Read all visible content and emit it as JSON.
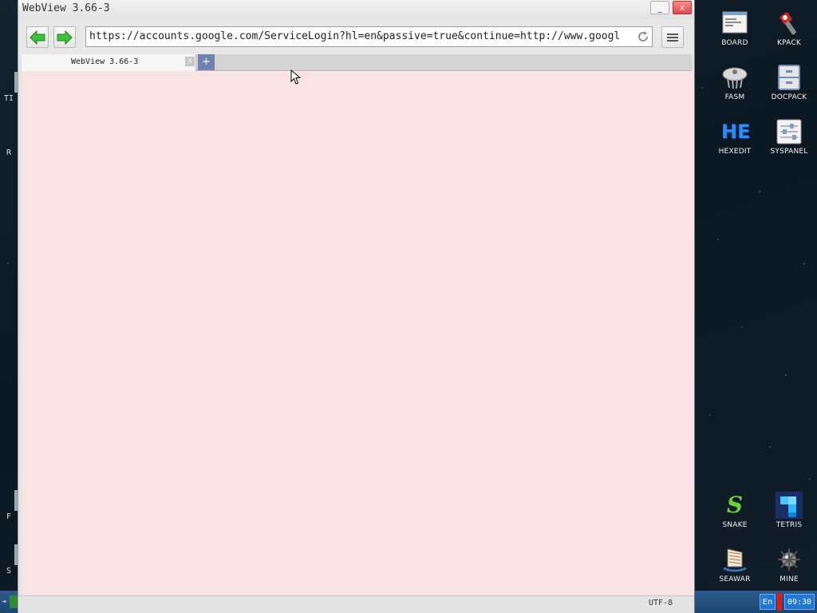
{
  "window": {
    "title": "WebView 3.66-3",
    "minimize_label": "_",
    "close_label": "x"
  },
  "toolbar": {
    "back_icon": "arrow-left-icon",
    "forward_icon": "arrow-right-icon",
    "url": "https://accounts.google.com/ServiceLogin?hl=en&passive=true&continue=http://www.googl",
    "reload_icon": "reload-icon",
    "menu_icon": "hamburger-menu-icon"
  },
  "tabs": [
    {
      "label": "WebView 3.66-3",
      "close_label": "x",
      "active": true
    }
  ],
  "newtab_label": "+",
  "statusbar": {
    "encoding": "UTF-8"
  },
  "colors": {
    "content_bg": "#fae3e3",
    "nav_arrow": "#3cc23c",
    "close_button": "#e04848",
    "newtab": "#6f82b2",
    "taskbar": "#1c4670"
  },
  "desktop_icons": [
    {
      "label": "BOARD",
      "icon": "board-icon"
    },
    {
      "label": "KPACK",
      "icon": "kpack-icon"
    },
    {
      "label": "FASM",
      "icon": "fasm-icon"
    },
    {
      "label": "DOCPACK",
      "icon": "docpack-icon"
    },
    {
      "label": "HEXEDIT",
      "icon": "hexedit-icon",
      "glyph": "HE"
    },
    {
      "label": "SYSPANEL",
      "icon": "syspanel-icon"
    },
    {
      "label": "SNAKE",
      "icon": "snake-icon",
      "glyph": "S"
    },
    {
      "label": "TETRIS",
      "icon": "tetris-icon"
    },
    {
      "label": "SEAWAR",
      "icon": "seawar-icon"
    },
    {
      "label": "MINE",
      "icon": "mine-icon"
    }
  ],
  "left_edge_labels": [
    "TI",
    "R",
    "F",
    "S"
  ],
  "taskbar": {
    "left_text": "◄",
    "language": "En",
    "clock": "09:30"
  }
}
